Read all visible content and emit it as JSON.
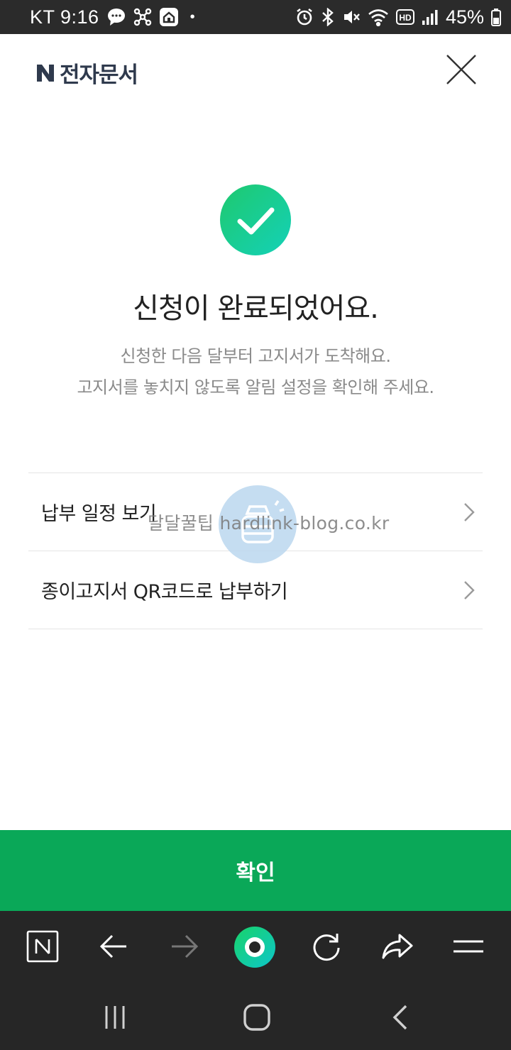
{
  "status_bar": {
    "carrier_time": "KT 9:16",
    "dot": "•",
    "battery": "45%",
    "icons": [
      "chat-bubble-icon",
      "network-share-icon",
      "home-app-icon",
      "alarm-icon",
      "bluetooth-icon",
      "mute-icon",
      "wifi-icon",
      "hd-icon",
      "signal-icon",
      "battery-icon"
    ]
  },
  "header": {
    "brand_letter": "N",
    "brand_title": "전자문서",
    "close_icon": "close-icon"
  },
  "result": {
    "icon": "check-circle-icon",
    "title": "신청이 완료되었어요.",
    "desc_line1": "신청한 다음 달부터 고지서가 도착해요.",
    "desc_line2": "고지서를 놓치지 않도록 알림 설정을 확인해 주세요."
  },
  "menu": {
    "items": [
      {
        "label": "납부 일정 보기"
      },
      {
        "label": "종이고지서 QR코드로 납부하기"
      }
    ]
  },
  "watermark": {
    "text": "달달꿀팁 hardlink-blog.co.kr"
  },
  "confirm": {
    "label": "확인"
  },
  "colors": {
    "accent_green": "#0aa858",
    "check_gradient_start": "#1ec96e",
    "check_gradient_end": "#14d1b8",
    "brand_navy": "#2f3a4d"
  },
  "toolbar": {
    "icons": [
      "naver-home-icon",
      "back-arrow-icon",
      "forward-arrow-icon",
      "green-dot-icon",
      "refresh-icon",
      "share-icon",
      "menu-icon"
    ]
  },
  "navbar": {
    "icons": [
      "recent-apps-icon",
      "home-icon",
      "back-icon"
    ]
  }
}
